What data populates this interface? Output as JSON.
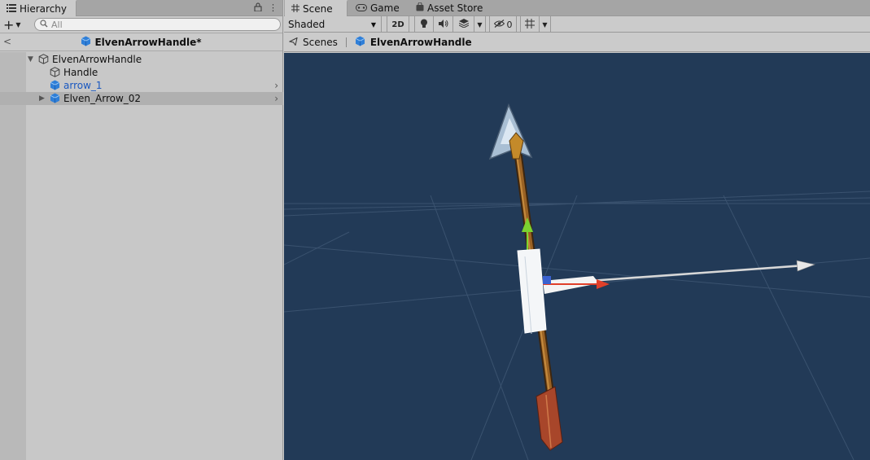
{
  "hierarchy": {
    "tab_label": "Hierarchy",
    "search_placeholder": "All",
    "header_title": "ElvenArrowHandle*",
    "tree": [
      {
        "label": "ElvenArrowHandle",
        "icon": "gameobject-outline-icon",
        "expanded": true
      },
      {
        "label": "Handle",
        "icon": "gameobject-outline-icon"
      },
      {
        "label": "arrow_1",
        "icon": "prefab-cube-icon",
        "prefab": true
      },
      {
        "label": "Elven_Arrow_02",
        "icon": "prefab-cube-icon",
        "selected": true,
        "collapsed": true
      }
    ]
  },
  "scene": {
    "tabs": [
      {
        "label": "Scene",
        "icon": "hash-icon",
        "active": true
      },
      {
        "label": "Game",
        "icon": "gamepad-icon"
      },
      {
        "label": "Asset Store",
        "icon": "bag-icon"
      }
    ],
    "shading_mode": "Shaded",
    "toggle_2d": "2D",
    "hidden_count": "0",
    "breadcrumb": {
      "root": "Scenes",
      "current": "ElvenArrowHandle"
    }
  },
  "colors": {
    "viewport_bg": "#223a57",
    "accent_blue": "#1a58c0",
    "gizmo_x": "#e0402a",
    "gizmo_y": "#7cd330",
    "gizmo_z": "#3a62d0"
  }
}
